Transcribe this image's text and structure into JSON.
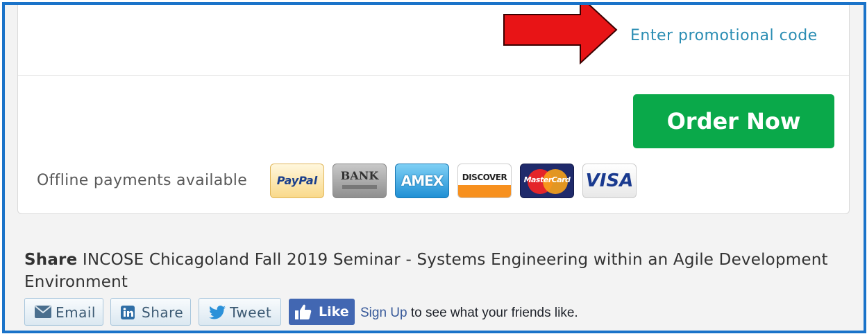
{
  "promo": {
    "link_label": "Enter promotional code"
  },
  "order": {
    "button_label": "Order Now"
  },
  "payments": {
    "offline_label": "Offline payments available",
    "methods": [
      {
        "name": "PayPal",
        "label": "PayPal"
      },
      {
        "name": "Bank",
        "label": "BANK"
      },
      {
        "name": "American Express",
        "label": "AMEX"
      },
      {
        "name": "Discover",
        "label": "DISCOVER"
      },
      {
        "name": "MasterCard",
        "label": "MasterCard"
      },
      {
        "name": "Visa",
        "label": "VISA"
      }
    ]
  },
  "share": {
    "lead": "Share",
    "event_title": "INCOSE Chicagoland Fall 2019 Seminar - Systems Engineering within an Agile Development Environment",
    "buttons": {
      "email": "Email",
      "linkedin": "Share",
      "twitter": "Tweet"
    },
    "facebook": {
      "like_label": "Like",
      "signup_link": "Sign Up",
      "signup_suffix": " to see what your friends like."
    }
  },
  "colors": {
    "frame_border": "#1a73c9",
    "order_button": "#0aa94a",
    "promo_link": "#2a8db3",
    "arrow": "#e81416",
    "facebook_blue": "#4267b2"
  },
  "icons": [
    "arrow-right-icon",
    "envelope-icon",
    "linkedin-icon",
    "twitter-bird-icon",
    "thumbs-up-icon"
  ]
}
